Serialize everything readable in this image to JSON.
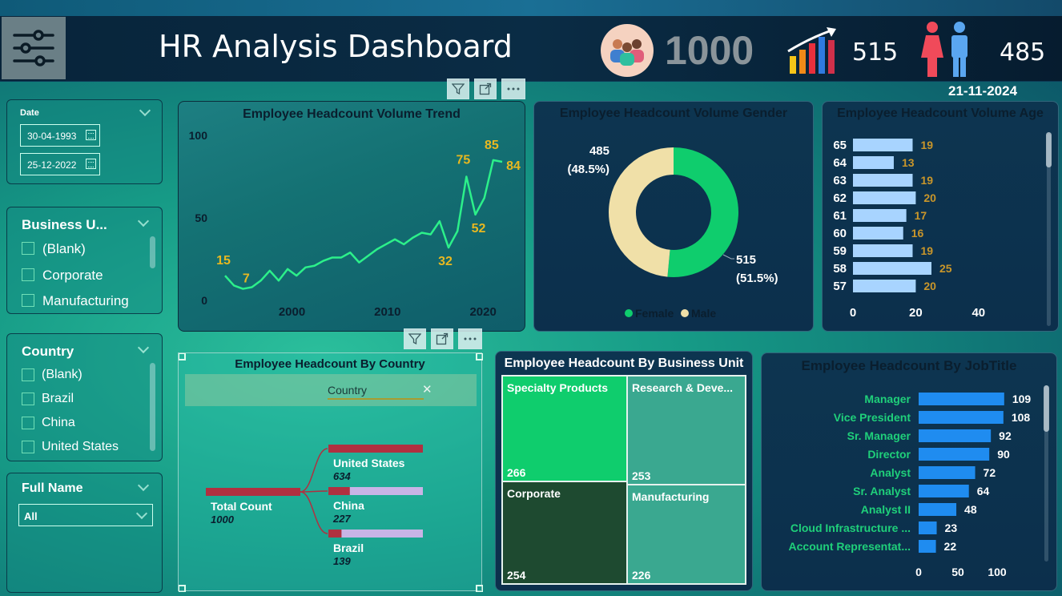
{
  "header": {
    "title": "HR Analysis Dashboard",
    "total_headcount": "1000",
    "male_count": "515",
    "female_count": "485",
    "date": "21-11-2024"
  },
  "slicers": {
    "date": {
      "label": "Date",
      "start": "30-04-1993",
      "end": "25-12-2022"
    },
    "business_unit": {
      "label": "Business U...",
      "options": [
        "(Blank)",
        "Corporate",
        "Manufacturing"
      ]
    },
    "country": {
      "label": "Country",
      "options": [
        "(Blank)",
        "Brazil",
        "China",
        "United States"
      ]
    },
    "full_name": {
      "label": "Full Name",
      "selected": "All"
    }
  },
  "colors": {
    "accent_green": "#2cf08a",
    "label_gold": "#e8b820",
    "bar_blue": "#1f8cf0",
    "bar_light_blue": "#a8d4ff",
    "donut_green": "#0fcd6d",
    "donut_cream": "#f0e0a8",
    "tree_red": "#b03040",
    "tree_lilac": "#c8b4e6"
  },
  "chart_data": [
    {
      "type": "line",
      "title": "Employee Headcount Volume Trend",
      "x": [
        1993,
        1994,
        1995,
        1996,
        1997,
        1998,
        1999,
        2000,
        2001,
        2002,
        2003,
        2004,
        2005,
        2006,
        2007,
        2008,
        2009,
        2010,
        2011,
        2012,
        2013,
        2014,
        2015,
        2016,
        2017,
        2018,
        2019,
        2020,
        2021,
        2022
      ],
      "y": [
        15,
        9,
        7,
        8,
        12,
        18,
        12,
        19,
        15,
        20,
        21,
        24,
        26,
        26,
        29,
        23,
        27,
        31,
        34,
        37,
        34,
        38,
        41,
        40,
        48,
        32,
        42,
        75,
        52,
        62,
        85,
        84
      ],
      "ylim": [
        0,
        100
      ],
      "yticks": [
        "0",
        "50",
        "100"
      ],
      "xticks": [
        "2000",
        "2010",
        "2020"
      ],
      "data_labels": [
        "15",
        "7",
        "32",
        "52",
        "75",
        "85",
        "84"
      ]
    },
    {
      "type": "pie",
      "title": "Employee Headcount Volume Gender",
      "labels": [
        "Female",
        "Male"
      ],
      "values": [
        515,
        485
      ],
      "percent_labels": [
        "(51.5%)",
        "(48.5%)"
      ]
    },
    {
      "type": "bar",
      "title": "Employee Headcount Volume Age",
      "categories": [
        "65",
        "64",
        "63",
        "62",
        "61",
        "60",
        "59",
        "58",
        "57"
      ],
      "values": [
        19,
        13,
        19,
        20,
        17,
        16,
        19,
        25,
        20
      ],
      "xticks": [
        "0",
        "20",
        "40"
      ]
    },
    {
      "type": "bar",
      "title": "Employee Headcount By Country",
      "field_label": "Country",
      "root": {
        "label": "Total Count",
        "value": "1000"
      },
      "categories": [
        "United States",
        "China",
        "Brazil"
      ],
      "values": [
        634,
        227,
        139
      ]
    },
    {
      "type": "heatmap",
      "title": "Employee Headcount By Business Unit",
      "categories": [
        "Specialty Products",
        "Research & Deve...",
        "Corporate",
        "Manufacturing"
      ],
      "values": [
        266,
        253,
        254,
        226
      ]
    },
    {
      "type": "bar",
      "title": "Employee Headcount By JobTitle",
      "categories": [
        "Manager",
        "Vice President",
        "Sr. Manager",
        "Director",
        "Analyst",
        "Sr. Analyst",
        "Analyst II",
        "Cloud Infrastructure ...",
        "Account Representat..."
      ],
      "values": [
        109,
        108,
        92,
        90,
        72,
        64,
        48,
        23,
        22
      ],
      "xticks": [
        "0",
        "50",
        "100"
      ]
    }
  ]
}
